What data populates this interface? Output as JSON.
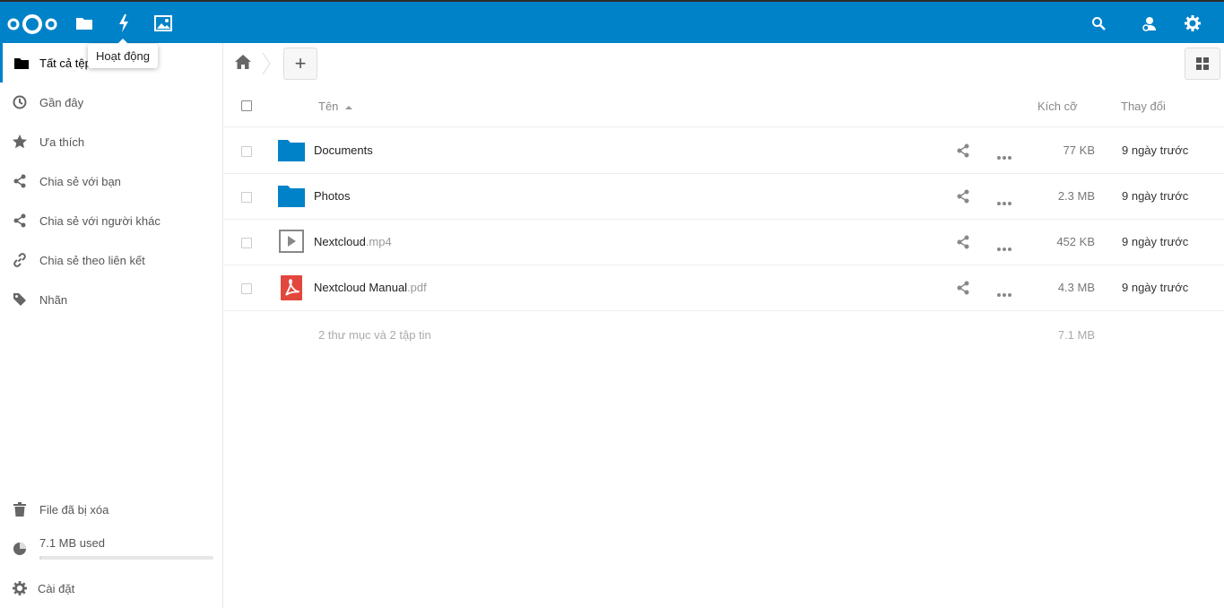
{
  "header": {
    "apps": [
      {
        "name": "files",
        "icon": "folder-icon"
      },
      {
        "name": "activity",
        "icon": "lightning-icon"
      },
      {
        "name": "gallery",
        "icon": "image-icon"
      }
    ],
    "tooltip": "Hoạt động",
    "right_icons": [
      "search-icon",
      "contacts-icon",
      "gear-icon"
    ],
    "brand_color": "#0082c9"
  },
  "sidebar": {
    "items": [
      {
        "label": "Tất cả tệp",
        "icon": "folder-icon",
        "active": true
      },
      {
        "label": "Gần đây",
        "icon": "clock-icon"
      },
      {
        "label": "Ưa thích",
        "icon": "star-icon"
      },
      {
        "label": "Chia sẻ với bạn",
        "icon": "share-icon"
      },
      {
        "label": "Chia sẻ với người khác",
        "icon": "share-icon"
      },
      {
        "label": "Chia sẻ theo liên kết",
        "icon": "link-icon"
      },
      {
        "label": "Nhãn",
        "icon": "tag-icon"
      }
    ],
    "deleted_files": "File đã bị xóa",
    "quota_label": "7.1 MB used",
    "quota_fraction": 0.0,
    "settings": "Cài đặt"
  },
  "toolbar": {
    "new_label": "+"
  },
  "table": {
    "columns": {
      "name": "Tên",
      "size": "Kích cỡ",
      "modified": "Thay đổi"
    },
    "rows": [
      {
        "name": "Documents",
        "ext": "",
        "type": "folder",
        "size": "77 KB",
        "modified": "9 ngày trước"
      },
      {
        "name": "Photos",
        "ext": "",
        "type": "folder",
        "size": "2.3 MB",
        "modified": "9 ngày trước"
      },
      {
        "name": "Nextcloud",
        "ext": ".mp4",
        "type": "video",
        "size": "452 KB",
        "modified": "9 ngày trước"
      },
      {
        "name": "Nextcloud Manual",
        "ext": ".pdf",
        "type": "pdf",
        "size": "4.3 MB",
        "modified": "9 ngày trước"
      }
    ],
    "summary": "2 thư mục và 2 tập tin",
    "summary_size": "7.1 MB"
  }
}
